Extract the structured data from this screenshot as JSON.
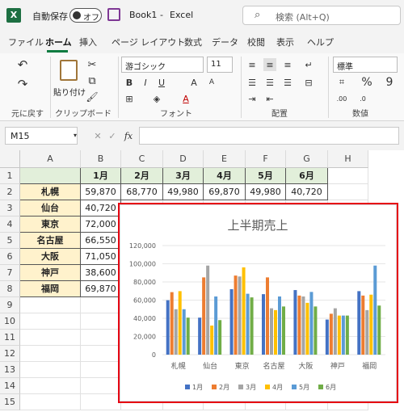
{
  "titlebar": {
    "autosave_label": "自動保存",
    "toggle_label": "オフ",
    "filename": "Book1",
    "separator": "-",
    "app": "Excel",
    "search_placeholder": "検索 (Alt+Q)"
  },
  "menu": [
    "ファイル",
    "ホーム",
    "挿入",
    "ページ レイアウト",
    "数式",
    "データ",
    "校閲",
    "表示",
    "ヘルプ"
  ],
  "ribbon": {
    "undo_group": "元に戻す",
    "clipboard_group": "クリップボード",
    "paste_label": "貼り付け",
    "font_group": "フォント",
    "font_name": "游ゴシック",
    "font_size": "11",
    "align_group": "配置",
    "number_group": "数値",
    "number_format": "標準"
  },
  "formula": {
    "name_box": "M15",
    "fx": "fx"
  },
  "sheet": {
    "columns": [
      "A",
      "B",
      "C",
      "D",
      "E",
      "F",
      "G",
      "H"
    ],
    "rows": [
      "1",
      "2",
      "3",
      "4",
      "5",
      "6",
      "7",
      "8",
      "9",
      "10",
      "11",
      "12",
      "13",
      "14",
      "15"
    ],
    "headers": [
      "1月",
      "2月",
      "3月",
      "4月",
      "5月",
      "6月"
    ],
    "cities": [
      "札幌",
      "仙台",
      "東京",
      "名古屋",
      "大阪",
      "神戸",
      "福岡"
    ],
    "row2_values": [
      "59,870",
      "68,770",
      "49,980",
      "69,870",
      "49,980",
      "40,720"
    ],
    "col_b_values": [
      "59,870",
      "40,720",
      "72,000",
      "66,550",
      "71,050",
      "38,600",
      "69,870"
    ]
  },
  "chart_data": {
    "type": "bar",
    "title": "上半期売上",
    "categories": [
      "札幌",
      "仙台",
      "東京",
      "名古屋",
      "大阪",
      "神戸",
      "福岡"
    ],
    "ylim": [
      0,
      120000
    ],
    "yticks": [
      "0",
      "20,000",
      "40,000",
      "60,000",
      "80,000",
      "100,000",
      "120,000"
    ],
    "series": [
      {
        "name": "1月",
        "color": "#4472c4",
        "values": [
          59870,
          40720,
          72000,
          66550,
          71050,
          38600,
          69870
        ]
      },
      {
        "name": "2月",
        "color": "#ed7d31",
        "values": [
          68770,
          85000,
          87000,
          85000,
          65000,
          45000,
          65000
        ]
      },
      {
        "name": "3月",
        "color": "#a5a5a5",
        "values": [
          49980,
          98000,
          86000,
          51000,
          64000,
          51000,
          49000
        ]
      },
      {
        "name": "4月",
        "color": "#ffc000",
        "values": [
          69870,
          32000,
          96000,
          49000,
          57000,
          43000,
          66000
        ]
      },
      {
        "name": "5月",
        "color": "#5b9bd5",
        "values": [
          49980,
          64000,
          67000,
          64000,
          69000,
          43000,
          98000
        ]
      },
      {
        "name": "6月",
        "color": "#70ad47",
        "values": [
          40720,
          38000,
          63000,
          53000,
          53000,
          43000,
          54000
        ]
      }
    ],
    "legend": "bottom"
  }
}
